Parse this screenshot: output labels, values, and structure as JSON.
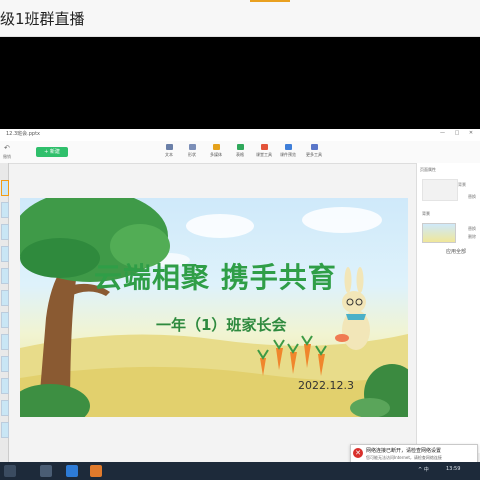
{
  "live": {
    "title": "级1班群直播"
  },
  "app": {
    "title": "12.3班会.pptx",
    "window_buttons": "— □ ✕",
    "undo_label": "撤销",
    "new_button": "+ 新建",
    "tools": [
      {
        "label": "文本",
        "color": "#6a7fa8",
        "icon": "text-icon"
      },
      {
        "label": "形状",
        "color": "#7c8fb8",
        "icon": "shape-icon"
      },
      {
        "label": "多媒体",
        "color": "#e5a21c",
        "icon": "media-icon"
      },
      {
        "label": "表格",
        "color": "#2fa85b",
        "icon": "table-icon"
      },
      {
        "label": "课堂工具",
        "color": "#e3543a",
        "icon": "class-tools-icon"
      },
      {
        "label": "课件预览",
        "color": "#3f7fd9",
        "icon": "preview-icon"
      },
      {
        "label": "更多工具",
        "color": "#5a76c9",
        "icon": "more-tools-icon"
      }
    ]
  },
  "slide": {
    "title": "云端相聚  携手共育",
    "subtitle": "一年（1）班家长会",
    "date": "2022.12.3",
    "colors": {
      "title": "#2f9e47",
      "subtitle": "#2e8a3e",
      "date": "#333333"
    }
  },
  "panel": {
    "title": "页面属性",
    "label1": "背景",
    "label2": "替换",
    "sub": "背景",
    "label3": "替换",
    "label4": "删除",
    "button": "应用全部"
  },
  "notification": {
    "line1": "网络连接已断开，请检查网络设置",
    "line2": "您可能无法访问Internet，请检查网络连接"
  },
  "taskbar": {
    "tray": "^ 中",
    "time": "13:59"
  }
}
